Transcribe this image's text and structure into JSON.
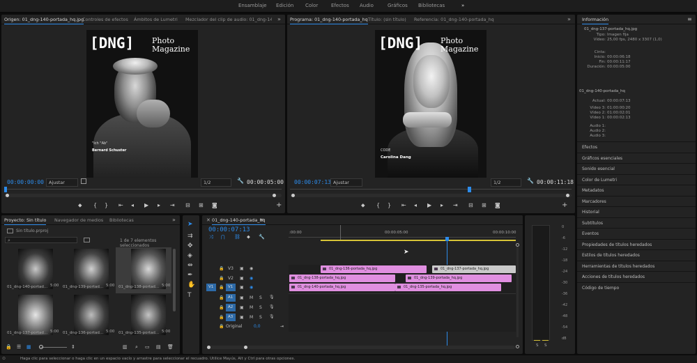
{
  "workspaces": [
    "Ensamblaje",
    "Edición",
    "Color",
    "Efectos",
    "Audio",
    "Gráficos",
    "Bibliotecas"
  ],
  "workspaces_more": "»",
  "source_monitor": {
    "tabs": [
      "Origen: 01_dng-140-portada_hq.jpg",
      "Controles de efectos",
      "Ámbitos de Lumetri",
      "Mezclador del clip de audio: 01_dng-140-portada"
    ],
    "more": "»",
    "timecode_in": "00:00:00:00",
    "fit": "Ajustar",
    "resolution": "1/2",
    "timecode_out": "00:00:05:00",
    "cover": {
      "brand": "[DNG]",
      "title_line1": "Photo",
      "title_line2": "Magazine",
      "headline": "\"Ich \"Ab\"",
      "name": "Bernard Schuster"
    }
  },
  "program_monitor": {
    "tabs": [
      "Programa: 01_dng-140-portada_hq",
      "Título: (sin título)",
      "Referencia: 01_dng-140-portada_hq"
    ],
    "more": "»",
    "timecode_in": "00:00:07:13",
    "fit": "Ajustar",
    "resolution": "1/2",
    "timecode_out": "00:00:11:18",
    "cover": {
      "brand": "[DNG]",
      "title_line1": "Photo",
      "title_line2": "Magazine",
      "headline": "CODE",
      "name": "Carolina Dang"
    }
  },
  "info_panel": {
    "title": "Información",
    "file": "01_dng-137-portada_hq.jpg",
    "rows": [
      {
        "k": "Tipo:",
        "v": "Imagen fija"
      },
      {
        "k": "Vídeo:",
        "v": "25,00 fps, 2480 x 3307 (1,0)"
      },
      {
        "k": "Cinta:",
        "v": ""
      },
      {
        "k": "Inicio:",
        "v": "00:00:06:18"
      },
      {
        "k": "Fin:",
        "v": "00:00:11:17"
      },
      {
        "k": "Duración:",
        "v": "00:00:05:00"
      }
    ],
    "sequence": "01_dng-140-portada_hq",
    "seq_rows": [
      {
        "k": "Actual:",
        "v": "00:00:07:13"
      },
      {
        "k": "Vídeo 3:",
        "v": "01:00:00:20"
      },
      {
        "k": "Vídeo 2:",
        "v": "01:00:02:01"
      },
      {
        "k": "Vídeo 1:",
        "v": "00:00:02:13"
      },
      {
        "k": "Audio 1:",
        "v": ""
      },
      {
        "k": "Audio 2:",
        "v": ""
      },
      {
        "k": "Audio 3:",
        "v": ""
      }
    ],
    "sections": [
      "Efectos",
      "Gráficos esenciales",
      "Sonido esencial",
      "Color de Lumetri",
      "Metadatos",
      "Marcadores",
      "Historial",
      "Subtítulos",
      "Eventos",
      "Propiedades de títulos heredados",
      "Estilos de títulos heredados",
      "Herramientas de títulos heredados",
      "Acciones de títulos heredados",
      "Código de tiempo"
    ]
  },
  "project": {
    "tabs": [
      "Proyecto: Sin título",
      "Navegador de medios",
      "Bibliotecas"
    ],
    "more": "»",
    "file": "Sin título.prproj",
    "selection": "1 de 7 elementos seleccionados",
    "items": [
      {
        "label": "01_dng-140-portad...",
        "dur": "5:00"
      },
      {
        "label": "01_dng-139-portad...",
        "dur": "5:00"
      },
      {
        "label": "01_dng-138-portad...",
        "dur": "5:00"
      },
      {
        "label": "01_dng-137-portad...",
        "dur": "5:00"
      },
      {
        "label": "01_dng-136-portad...",
        "dur": "5:00"
      },
      {
        "label": "01_dng-135-portad...",
        "dur": "5:00"
      }
    ]
  },
  "timeline": {
    "tab": "01_dng-140-portada_hq",
    "timecode": "00:00:07:13",
    "ruler": [
      ":00:00",
      "00:00:05:00",
      "00:00:10:00"
    ],
    "tracks": [
      "V3",
      "V2",
      "V1",
      "A1",
      "A2",
      "A3"
    ],
    "v1_target": "V1",
    "original_label": "Original",
    "original_value": "0,0",
    "clips": {
      "v3a": "01_dng-136-portada_hq.jpg",
      "v3b": "01_dng-137-portada_hq.jpg",
      "v2a": "01_dng-138-portada_hq.jpg",
      "v2b": "01_dng-139-portada_hq.jpg",
      "v1a": "01_dng-140-portada_hq.jpg",
      "v1b": "01_dng-135-portada_hq.jpg"
    }
  },
  "audio_meter": {
    "scale": [
      "0",
      "-6",
      "-12",
      "-18",
      "-24",
      "-30",
      "-36",
      "-42",
      "-48",
      "-54",
      "dB"
    ],
    "solo_left": "S",
    "solo_right": "S"
  },
  "status_bar": "Haga clic para seleccionar o haga clic en un espacio vacío y arrastre para seleccionar el recuadro. Utilice Mayús, Alt y Ctrl para otras opciones.",
  "colors": {
    "accent": "#2d8ceb",
    "clip_pink": "#e08fe0",
    "clip_grey": "#cacaca",
    "playhead": "#2d8ceb",
    "work_area": "#d8c437"
  }
}
